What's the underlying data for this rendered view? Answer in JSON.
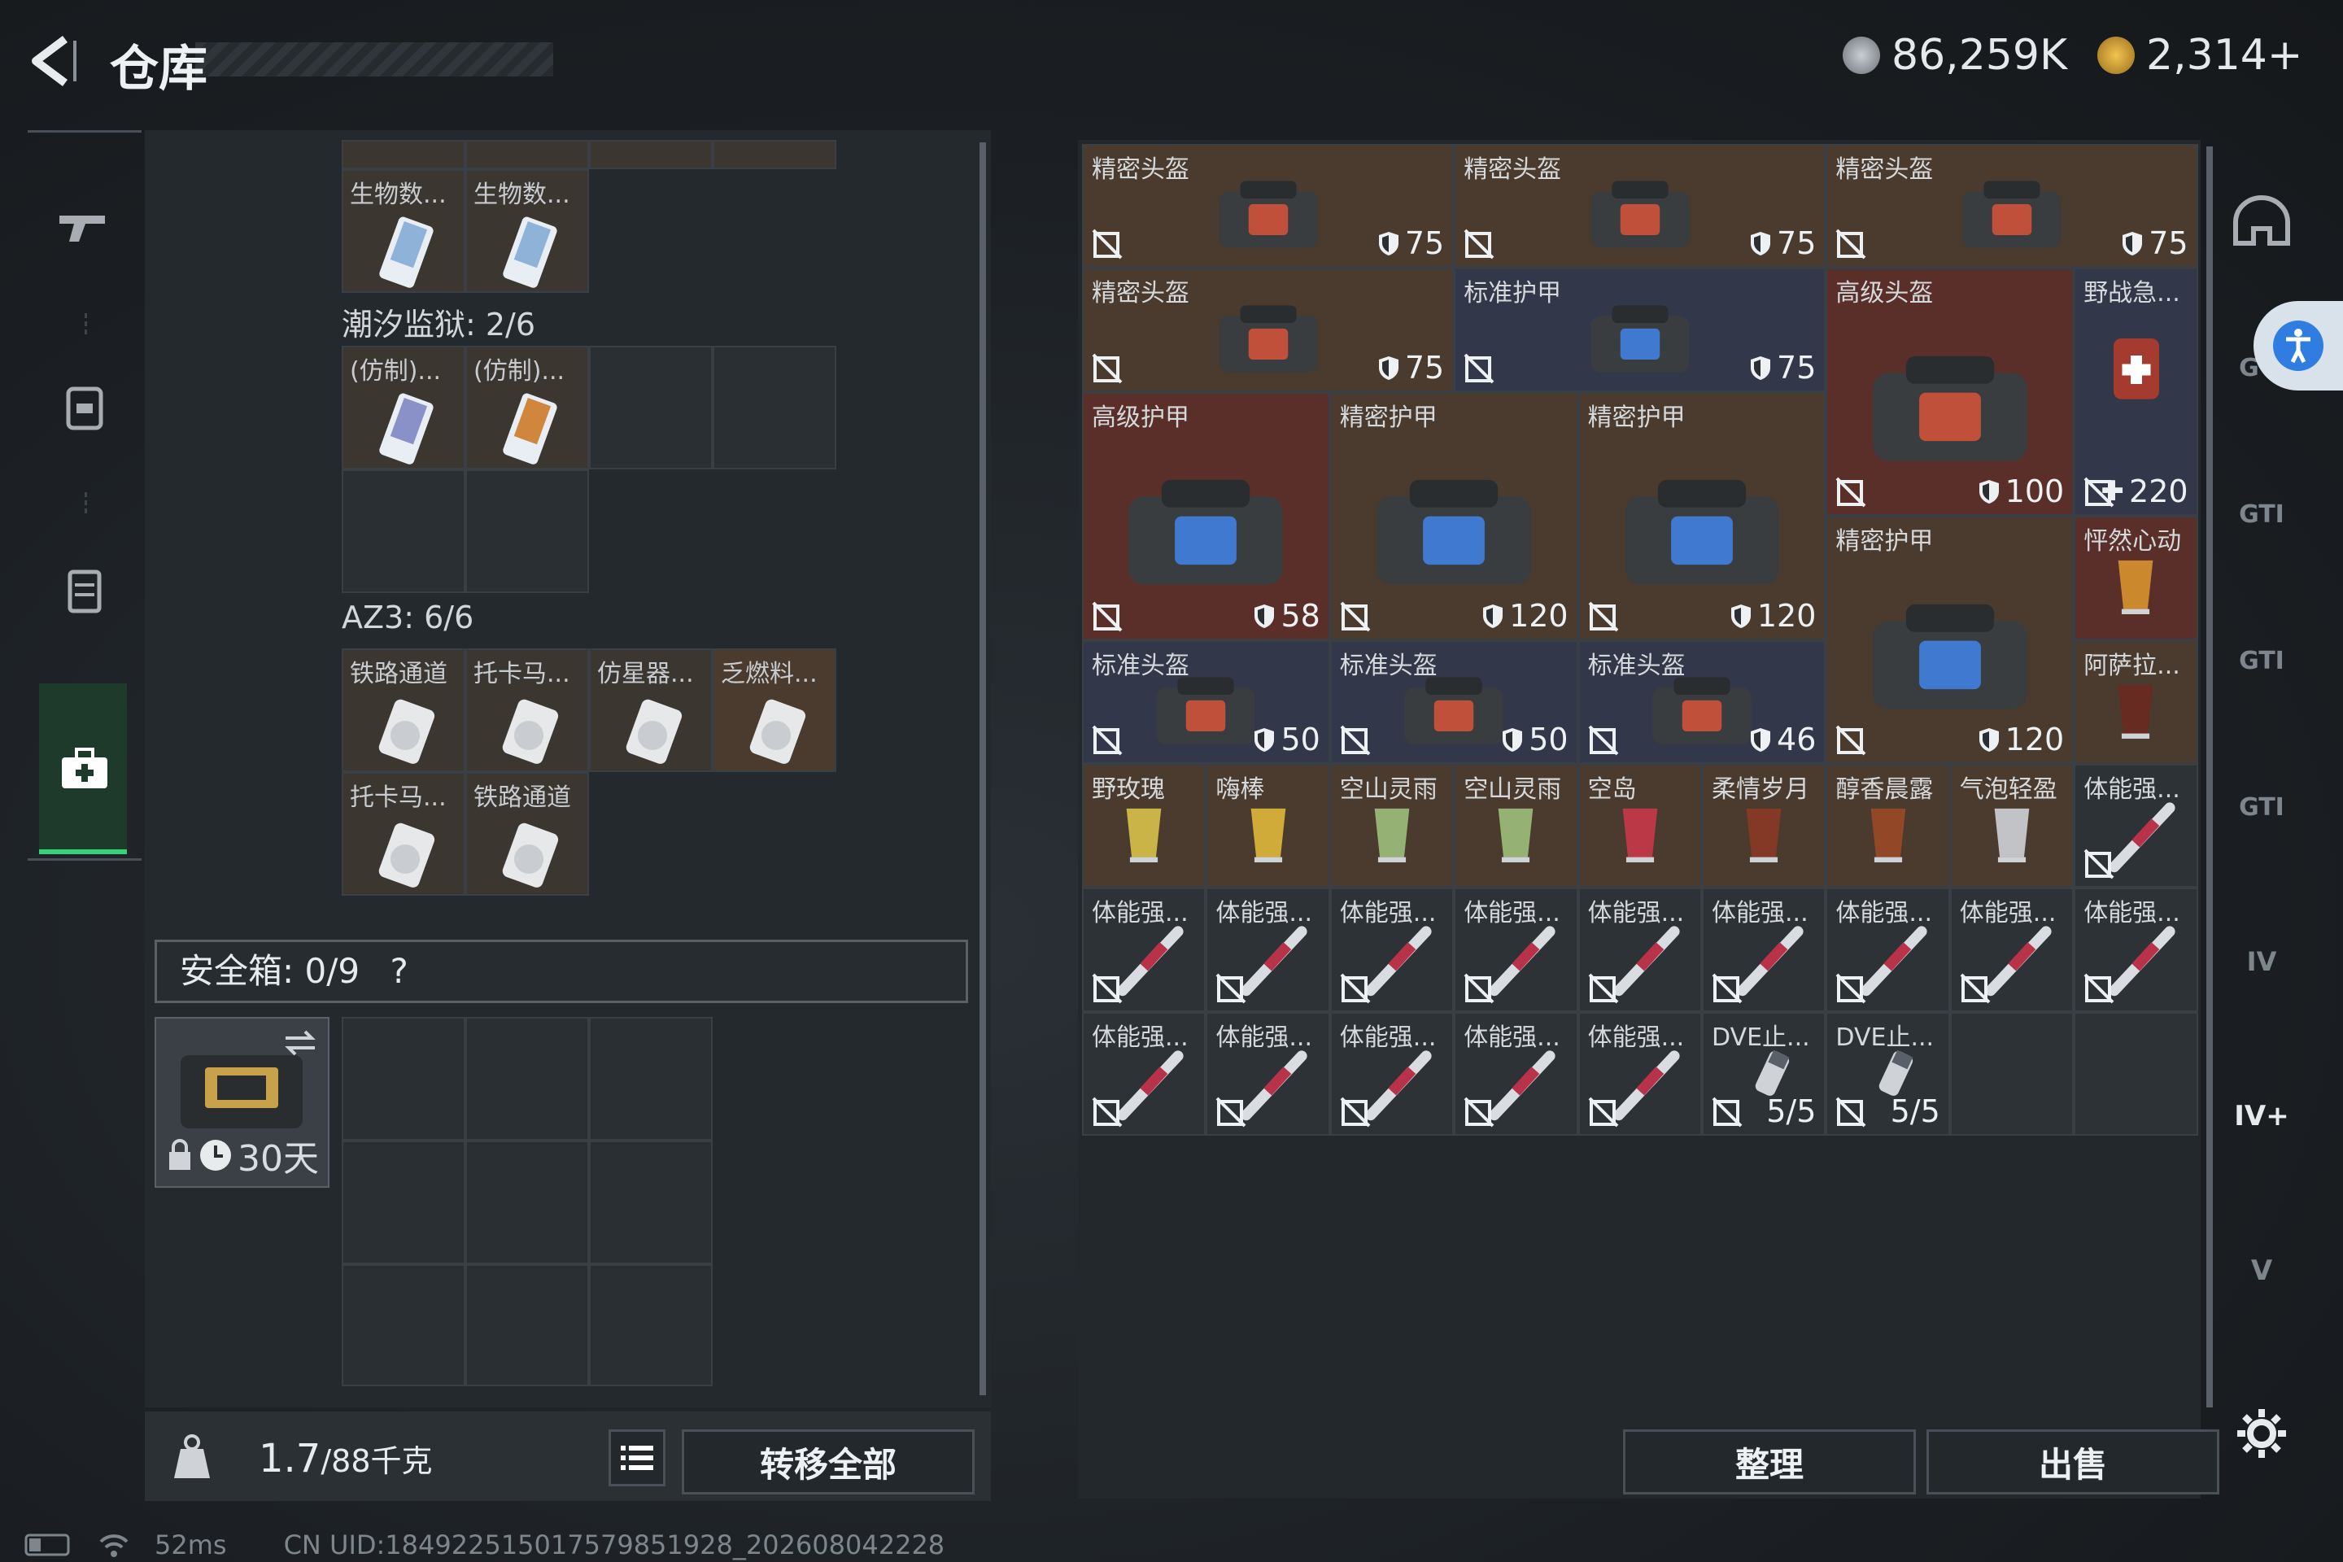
{
  "header": {
    "title": "仓库",
    "currency1": "86,259K",
    "currency2": "2,314+"
  },
  "left": {
    "top_labels": [
      "生物数...",
      "生物数..."
    ],
    "section1": "潮汐监狱: 2/6",
    "section1_items": [
      "(仿制)...",
      "(仿制)..."
    ],
    "section2": "AZ3: 6/6",
    "section2_row1": [
      "铁路通道",
      "托卡马...",
      "仿星器...",
      "乏燃料..."
    ],
    "section2_row2": [
      "托卡马...",
      "铁路通道"
    ],
    "safebox": "安全箱: 0/9",
    "safebox_help": "?",
    "safe_item_time": "30天",
    "weight": "1.7",
    "weight_max": "/88千克",
    "transfer_all": "转移全部"
  },
  "right": {
    "row1": [
      {
        "label": "精密头盔",
        "value": "75"
      },
      {
        "label": "精密头盔",
        "value": "75"
      },
      {
        "label": "精密头盔",
        "value": "75"
      }
    ],
    "row2": [
      {
        "label": "精密头盔",
        "value": "75"
      },
      {
        "label": "标准护甲",
        "value": "75"
      },
      {
        "label": "高级头盔",
        "value": "100"
      },
      {
        "label": "野战急...",
        "value": "220"
      }
    ],
    "row3": [
      {
        "label": "高级护甲",
        "value": "58"
      },
      {
        "label": "精密护甲",
        "value": "120"
      },
      {
        "label": "精密护甲",
        "value": "120"
      },
      {
        "label": "精密护甲",
        "value": "120"
      },
      {
        "label": "怦然心动",
        "value": ""
      }
    ],
    "row4": [
      {
        "label": "标准头盔",
        "value": "50"
      },
      {
        "label": "标准头盔",
        "value": "50"
      },
      {
        "label": "标准头盔",
        "value": "46"
      },
      {
        "label": "阿萨拉...",
        "value": ""
      }
    ],
    "drinks": [
      "野玫瑰",
      "嗨棒",
      "空山灵雨",
      "空山灵雨",
      "空岛",
      "柔情岁月",
      "醇香晨露",
      "气泡轻盈",
      "体能强..."
    ],
    "injectors_row": [
      "体能强...",
      "体能强...",
      "体能强...",
      "体能强...",
      "体能强...",
      "体能强...",
      "体能强...",
      "体能强...",
      "体能强..."
    ],
    "last_row": [
      "体能强...",
      "体能强...",
      "体能强...",
      "体能强...",
      "体能强...",
      "DVE止...",
      "DVE止..."
    ],
    "dve_count": "5/5",
    "organize": "整理",
    "sell": "出售"
  },
  "status": {
    "ping": "52ms",
    "uid": "CN UID:184922515017579851928_202608042228"
  },
  "colors": {
    "accent_green": "#3ad07a",
    "brown_slot": "#4a3b2e",
    "red_slot": "#5a2f2a",
    "blue_slot": "#33374a"
  }
}
